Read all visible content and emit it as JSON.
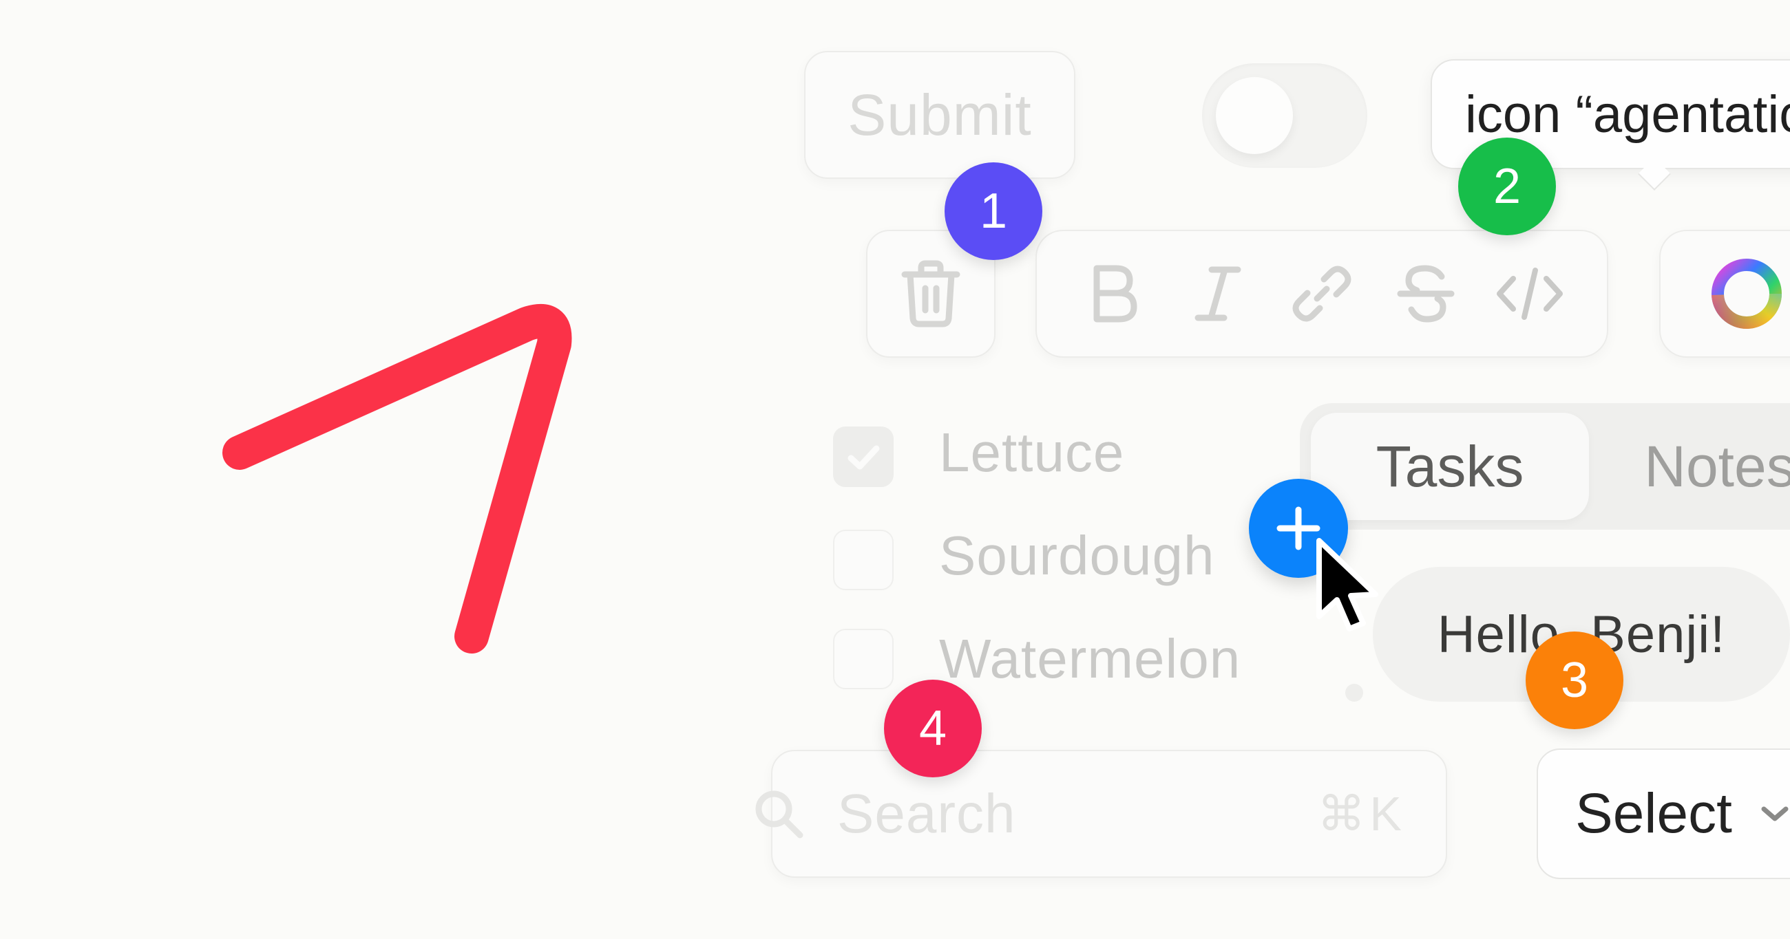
{
  "annotation": {
    "stroke_color": "#fb3248"
  },
  "controls": {
    "submit_label": "Submit",
    "toggle": {
      "state": "off"
    },
    "tooltip_text": "icon “agentatio",
    "format_buttons": [
      "bold",
      "italic",
      "link",
      "strikethrough",
      "code"
    ],
    "checklist": [
      {
        "label": "Lettuce",
        "checked": true
      },
      {
        "label": "Sourdough",
        "checked": false
      },
      {
        "label": "Watermelon",
        "checked": false
      }
    ],
    "tabs": [
      {
        "label": "Tasks",
        "active": true
      },
      {
        "label": "Notes",
        "active": false
      }
    ],
    "bubble_text": "Hello, Benji!",
    "search": {
      "placeholder": "Search",
      "shortcut": "⌘K"
    },
    "select_label": "Select"
  },
  "markers": [
    {
      "number": "1",
      "color": "#5b4df5"
    },
    {
      "number": "2",
      "color": "#17be4a"
    },
    {
      "number": "3",
      "color": "#fb8109"
    },
    {
      "number": "4",
      "color": "#f32558"
    }
  ],
  "add_button": {
    "color": "#0b83fb",
    "icon": "plus-icon"
  },
  "cursor": {
    "icon": "arrow-cursor-icon"
  }
}
